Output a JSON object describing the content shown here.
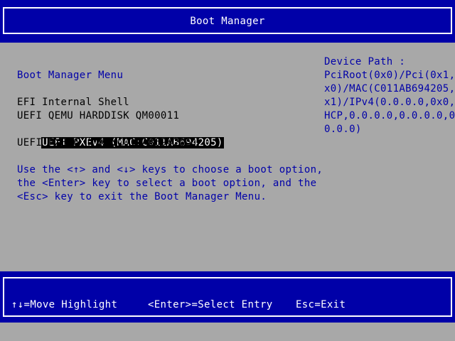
{
  "header": {
    "title": "Boot Manager"
  },
  "menu": {
    "heading": "Boot Manager Menu",
    "entries": [
      {
        "label": "EFI Internal Shell",
        "selected": false
      },
      {
        "label": "UEFI QEMU HARDDISK QM00011",
        "selected": false
      },
      {
        "label": "UEFI PXEv4 (MAC:C011AB694205)",
        "selected": true
      },
      {
        "label": "UEFI PXEv6 (MAC:C011AB694205)",
        "selected": false
      }
    ],
    "instructions": [
      "Use the <↑> and <↓> keys to choose a boot option,",
      "the <Enter> key to select a boot option, and the",
      "<Esc> key to exit the Boot Manager Menu."
    ]
  },
  "device_path": {
    "label": "Device Path :",
    "lines": [
      "PciRoot(0x0)/Pci(0x1,0",
      "x0)/MAC(C011AB694205,0",
      "x1)/IPv4(0.0.0.0,0x0,D",
      "HCP,0.0.0.0,0.0.0.0,0.",
      "0.0.0)"
    ]
  },
  "help_bar": {
    "move": "↑↓=Move Highlight",
    "select": "<Enter>=Select Entry",
    "exit": "Esc=Exit"
  },
  "colors": {
    "background": "#a8a8a8",
    "band": "#0000a8",
    "text_blue": "#0000a8",
    "highlight_bg": "#000000",
    "highlight_fg": "#ffffff"
  }
}
